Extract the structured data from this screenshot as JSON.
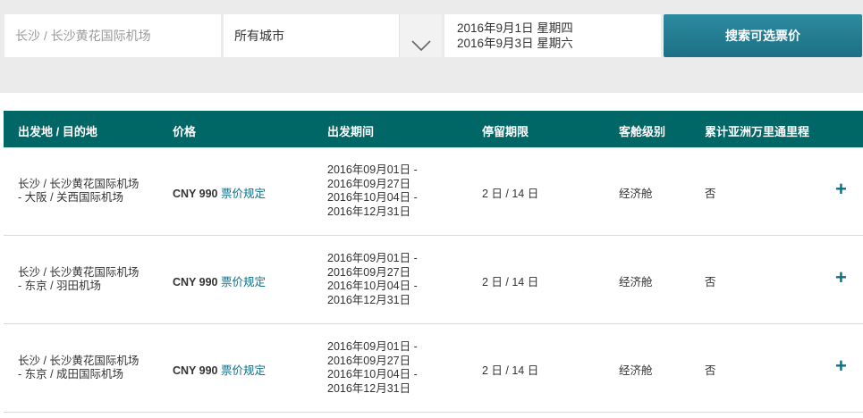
{
  "search": {
    "origin": "长沙 / 长沙黄花国际机场",
    "city_select": "所有城市",
    "date_start": "2016年9月1日 星期四",
    "date_end": "2016年9月3日 星期六",
    "button": "搜索可选票价"
  },
  "table": {
    "headers": [
      "出发地 / 目的地",
      "价格",
      "出发期间",
      "停留期限",
      "客舱级别",
      "累计亚洲万里通里程"
    ],
    "rows": [
      {
        "route_1": "长沙 / 长沙黄花国际机场",
        "route_2": "- 大阪 / 关西国际机场",
        "price": "CNY 990",
        "rules": "票价规定",
        "period": [
          "2016年09月01日 -",
          "2016年09月27日",
          "2016年10月04日 -",
          "2016年12月31日"
        ],
        "stay": "2 日 / 14 日",
        "cabin": "经济舱",
        "miles": "否",
        "expand": "+"
      },
      {
        "route_1": "长沙 / 长沙黄花国际机场",
        "route_2": "- 东京 / 羽田机场",
        "price": "CNY 990",
        "rules": "票价规定",
        "period": [
          "2016年09月01日 -",
          "2016年09月27日",
          "2016年10月04日 -",
          "2016年12月31日"
        ],
        "stay": "2 日 / 14 日",
        "cabin": "经济舱",
        "miles": "否",
        "expand": "+"
      },
      {
        "route_1": "长沙 / 长沙黄花国际机场",
        "route_2": "- 东京 / 成田国际机场",
        "price": "CNY 990",
        "rules": "票价规定",
        "period": [
          "2016年09月01日 -",
          "2016年09月27日",
          "2016年10月04日 -",
          "2016年12月31日"
        ],
        "stay": "2 日 / 14 日",
        "cabin": "经济舱",
        "miles": "否",
        "expand": "+"
      }
    ]
  },
  "colors": {
    "header_bg": "#006666",
    "button_bg": "#1d7085",
    "link": "#0b6f8a"
  },
  "icons": {
    "dropdown": "chevron-down-icon",
    "expand": "plus-icon"
  }
}
